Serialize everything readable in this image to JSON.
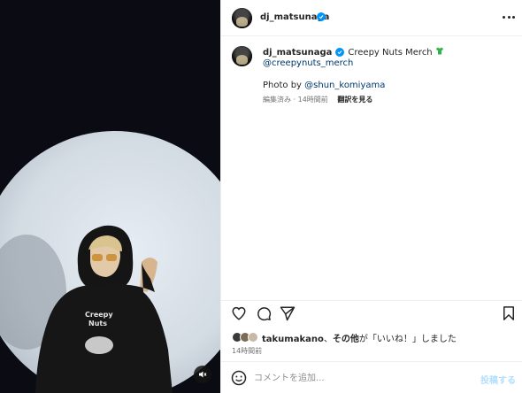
{
  "post": {
    "author": "dj_matsunaga",
    "caption": "Creepy Nuts Merch",
    "caption_emoji_icon": "tshirt-icon",
    "mention_link": "@creepynuts_merch",
    "photo_by_prefix": "Photo by ",
    "photo_by_link": "@shun_komiyama",
    "meta_text": "編集済み · 14時間前",
    "translate_label": "翻訳を見る"
  },
  "likes": {
    "first_user": "takumakano",
    "separator": "、",
    "others": "その他",
    "suffix": "が「いいね！」しました"
  },
  "timestamp": "14時間前",
  "comment": {
    "placeholder": "コメントを追加...",
    "post_label": "投稿する"
  },
  "icons": {
    "verified": "verified-badge-icon",
    "more": "more-options-icon",
    "like": "heart-icon",
    "comment": "comment-bubble-icon",
    "share": "send-icon",
    "save": "bookmark-icon",
    "emoji": "emoji-smile-icon",
    "mute": "speaker-muted-icon"
  },
  "colors": {
    "verified_blue": "#0095f6",
    "link_blue": "#00376b",
    "muted_text": "#737373",
    "post_button_disabled": "#b2dffc"
  }
}
